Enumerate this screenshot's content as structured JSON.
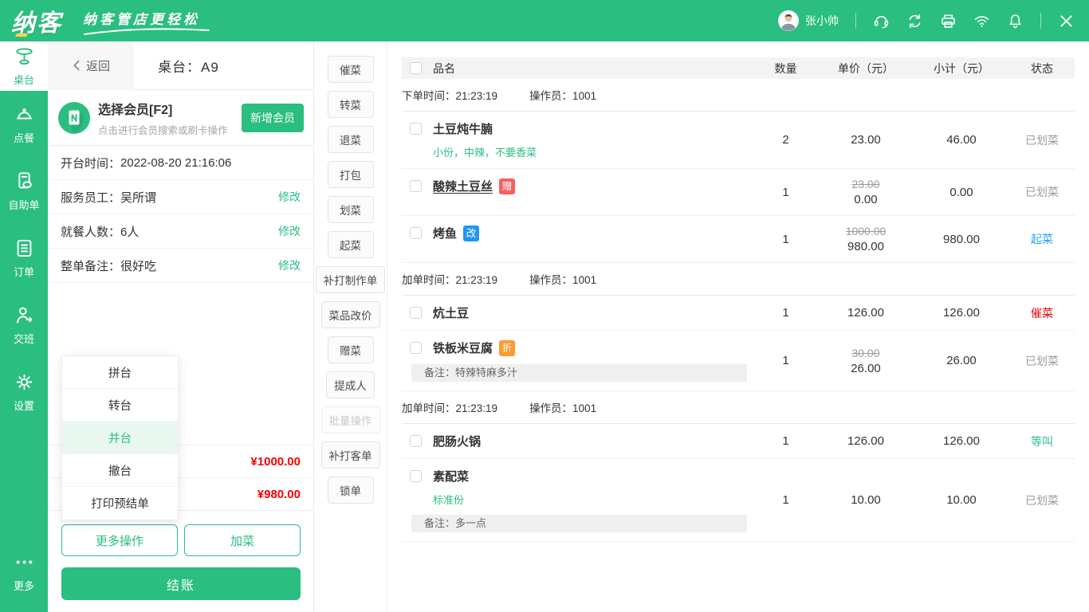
{
  "colors": {
    "brand_green": "#2abe80",
    "light_green_bg": "#e8f8f1",
    "price_red": "#f30000",
    "status_blue": "#2b9df3",
    "badge_red": "#f56060",
    "badge_blue": "#2196f3",
    "badge_orange": "#ff9a2d",
    "muted_gray": "#9b9b9b"
  },
  "topbar": {
    "logo": "纳客",
    "slogan": "纳客管店更轻松",
    "user_name": "张小帅",
    "icons": [
      "avatar",
      "support-headset",
      "sync",
      "printer",
      "wifi",
      "notification-bell",
      "close"
    ]
  },
  "sidebar": {
    "items": [
      {
        "label": "桌台",
        "icon": "table-icon",
        "active": true
      },
      {
        "label": "点餐",
        "icon": "cloche-icon",
        "active": false
      },
      {
        "label": "自助单",
        "icon": "self-order-icon",
        "active": false
      },
      {
        "label": "订单",
        "icon": "order-list-icon",
        "active": false
      },
      {
        "label": "交班",
        "icon": "shift-icon",
        "active": false
      },
      {
        "label": "设置",
        "icon": "gear-icon",
        "active": false
      }
    ],
    "more_label": "更多",
    "more_icon": "ellipsis-icon"
  },
  "panel": {
    "back_label": "返回",
    "title": "桌台：A9",
    "member": {
      "title": "选择会员[F2]",
      "subtitle": "点击进行会员搜索或刷卡操作",
      "add_button": "新增会员",
      "icon": "member-card-icon"
    },
    "info_rows": [
      {
        "label": "开台时间：",
        "value": "2022-08-20  21:16:06",
        "action": ""
      },
      {
        "label": "服务员工：",
        "value": "吴所谓",
        "action": "修改"
      },
      {
        "label": "就餐人数：",
        "value": "6人",
        "action": "修改"
      },
      {
        "label": "整单备注：",
        "value": "很好吃",
        "action": "修改"
      }
    ],
    "amount_rows": [
      {
        "amount": "¥1000.00"
      },
      {
        "amount": "¥980.00"
      }
    ],
    "more_ops_button": "更多操作",
    "add_dish_button": "加菜",
    "checkout_button": "结账"
  },
  "context_menu": {
    "items": [
      {
        "label": "拼台",
        "active": false
      },
      {
        "label": "转台",
        "active": false
      },
      {
        "label": "并台",
        "active": true
      },
      {
        "label": "撤台",
        "active": false
      },
      {
        "label": "打印预结单",
        "active": false
      }
    ]
  },
  "dish_actions": {
    "buttons": [
      {
        "label": "催菜",
        "disabled": false
      },
      {
        "label": "转菜",
        "disabled": false
      },
      {
        "label": "退菜",
        "disabled": false
      },
      {
        "label": "打包",
        "disabled": false
      },
      {
        "label": "划菜",
        "disabled": false
      },
      {
        "label": "起菜",
        "disabled": false
      },
      {
        "label": "补打制作单",
        "disabled": false
      },
      {
        "label": "菜品改价",
        "disabled": false
      },
      {
        "label": "赠菜",
        "disabled": false
      },
      {
        "label": "提成人",
        "disabled": false
      },
      {
        "label": "批量操作",
        "disabled": true
      },
      {
        "label": "补打客单",
        "disabled": false
      },
      {
        "label": "锁单",
        "disabled": false
      }
    ]
  },
  "order_table": {
    "headers": {
      "name": "品名",
      "qty": "数量",
      "unit_price": "单价（元）",
      "subtotal": "小计（元）",
      "status": "状态"
    },
    "groups": [
      {
        "time_label": "下单时间：21:23:19",
        "operator_label": "操作员：1001",
        "rows": [
          {
            "name": "土豆炖牛腩",
            "spec": "小份，中辣，不要香菜",
            "qty": "2",
            "price": "23.00",
            "subtotal": "46.00",
            "status": "已划菜"
          },
          {
            "name": "酸辣土豆丝",
            "badge": "赠",
            "qty": "1",
            "old_price": "23.00",
            "price": "0.00",
            "subtotal": "0.00",
            "status": "已划菜"
          },
          {
            "name": "烤鱼",
            "badge": "改",
            "qty": "1",
            "old_price": "1000.00",
            "price": "980.00",
            "subtotal": "980.00",
            "status": "起菜"
          }
        ]
      },
      {
        "time_label": "加单时间：21:23:19",
        "operator_label": "操作员：1001",
        "rows": [
          {
            "name": "炕土豆",
            "qty": "1",
            "price": "126.00",
            "subtotal": "126.00",
            "status": "催菜"
          },
          {
            "name": "铁板米豆腐",
            "badge": "折",
            "note": "备注：特辣特麻多汁",
            "qty": "1",
            "old_price": "30.00",
            "price": "26.00",
            "subtotal": "26.00",
            "status": "已划菜"
          }
        ]
      },
      {
        "time_label": "加单时间：21:23:19",
        "operator_label": "操作员：1001",
        "rows": [
          {
            "name": "肥肠火锅",
            "qty": "1",
            "price": "126.00",
            "subtotal": "126.00",
            "status": "等叫"
          },
          {
            "name": "素配菜",
            "spec": "标准份",
            "note": "备注：多一点",
            "qty": "1",
            "price": "10.00",
            "subtotal": "10.00",
            "status": "已划菜"
          }
        ]
      }
    ]
  }
}
